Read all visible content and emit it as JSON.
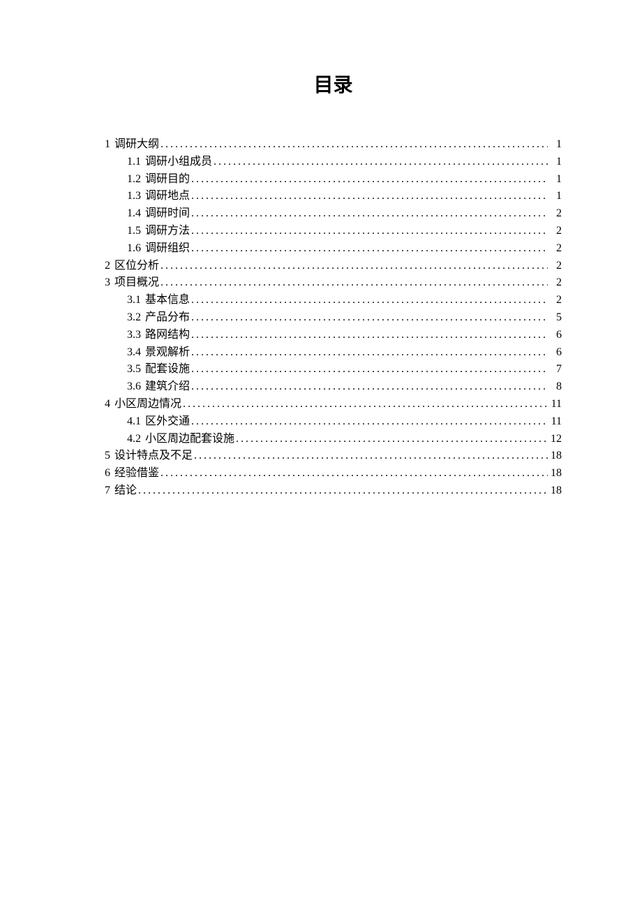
{
  "title": "目录",
  "toc": [
    {
      "level": 1,
      "num": "1",
      "text": "调研大纲",
      "page": "1"
    },
    {
      "level": 2,
      "num": "1.1",
      "text": "调研小组成员",
      "page": "1"
    },
    {
      "level": 2,
      "num": "1.2",
      "text": "调研目的",
      "page": "1"
    },
    {
      "level": 2,
      "num": "1.3",
      "text": "调研地点",
      "page": "1"
    },
    {
      "level": 2,
      "num": "1.4",
      "text": "调研时间",
      "page": "2"
    },
    {
      "level": 2,
      "num": "1.5",
      "text": "调研方法",
      "page": "2"
    },
    {
      "level": 2,
      "num": "1.6",
      "text": "调研组织",
      "page": "2"
    },
    {
      "level": 1,
      "num": "2",
      "text": "区位分析",
      "page": "2"
    },
    {
      "level": 1,
      "num": "3",
      "text": "项目概况",
      "page": "2"
    },
    {
      "level": 2,
      "num": "3.1",
      "text": "基本信息",
      "page": "2"
    },
    {
      "level": 2,
      "num": "3.2",
      "text": "产品分布",
      "page": "5"
    },
    {
      "level": 2,
      "num": "3.3",
      "text": "路网结构",
      "page": "6"
    },
    {
      "level": 2,
      "num": "3.4",
      "text": "景观解析",
      "page": "6"
    },
    {
      "level": 2,
      "num": "3.5",
      "text": "配套设施",
      "page": "7"
    },
    {
      "level": 2,
      "num": "3.6",
      "text": "建筑介绍",
      "page": "8"
    },
    {
      "level": 1,
      "num": "4",
      "text": "小区周边情况",
      "page": "11"
    },
    {
      "level": 2,
      "num": "4.1",
      "text": "区外交通",
      "page": "11"
    },
    {
      "level": 2,
      "num": "4.2",
      "text": "小区周边配套设施",
      "page": "12"
    },
    {
      "level": 1,
      "num": "5",
      "text": "设计特点及不足",
      "page": "18"
    },
    {
      "level": 1,
      "num": "6",
      "text": "经验借鉴",
      "page": "18"
    },
    {
      "level": 1,
      "num": "7",
      "text": "结论",
      "page": "18"
    }
  ]
}
